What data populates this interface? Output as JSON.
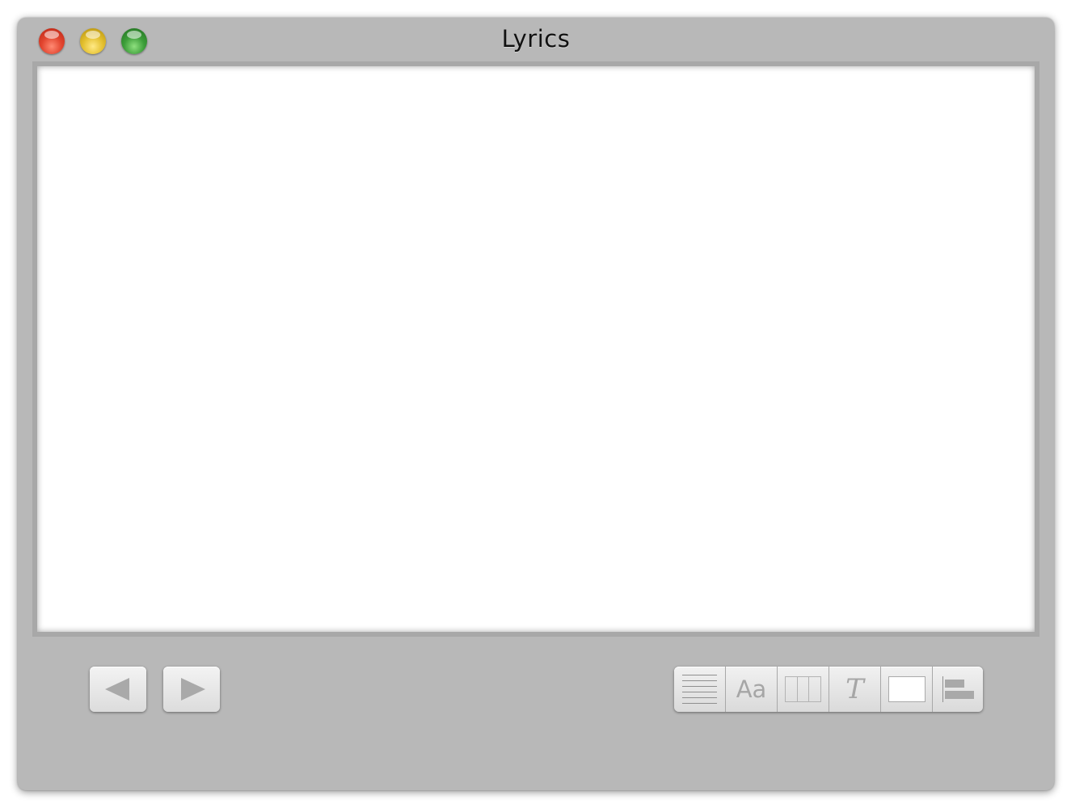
{
  "window": {
    "title": "Lyrics"
  },
  "titlebar": {
    "buttons": [
      {
        "name": "close",
        "color": "#e2452f"
      },
      {
        "name": "minimize",
        "color": "#e4c02f"
      },
      {
        "name": "zoom",
        "color": "#3d9e3a"
      }
    ]
  },
  "lyrics": {
    "text": ""
  },
  "navigation": {
    "previous_icon": "triangle-left-icon",
    "next_icon": "triangle-right-icon"
  },
  "format_bar": {
    "font_label": "Aa",
    "style_label": "T",
    "text_color": "#ffffff",
    "icons": [
      "lines-icon",
      "font-icon",
      "columns-icon",
      "style-icon",
      "color-well",
      "align-left-icon"
    ]
  }
}
